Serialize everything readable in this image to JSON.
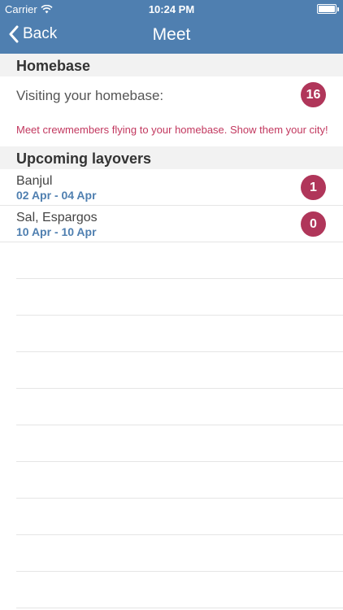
{
  "status_bar": {
    "carrier": "Carrier",
    "time": "10:24 PM",
    "wifi_icon": "wifi-icon",
    "battery_icon": "battery-icon"
  },
  "nav": {
    "back_label": "Back",
    "title": "Meet"
  },
  "homebase": {
    "header": "Homebase",
    "label": "Visiting your homebase:",
    "count": "16",
    "hint": "Meet crewmembers flying to your homebase. Show them your city!"
  },
  "layovers": {
    "header": "Upcoming layovers",
    "items": [
      {
        "city": "Banjul",
        "dates": "02 Apr - 04 Apr",
        "count": "1"
      },
      {
        "city": "Sal, Espargos",
        "dates": "10 Apr - 10 Apr",
        "count": "0"
      }
    ]
  },
  "colors": {
    "nav_bar": "#4f7fb0",
    "badge": "#b0365a",
    "hint_text": "#c2385f",
    "date_text": "#4f7fb0"
  }
}
